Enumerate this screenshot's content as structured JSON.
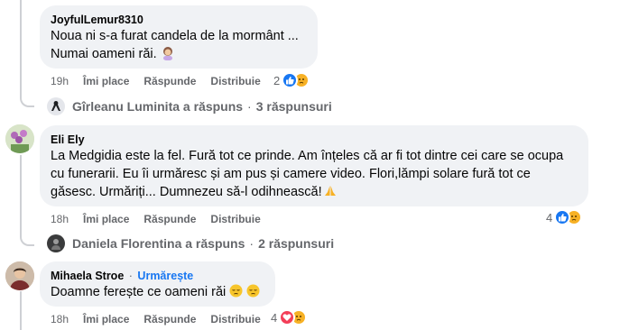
{
  "comments": [
    {
      "author": "JoyfulLemur8310",
      "line1": "Noua ni s-a furat candela de la mormânt ...",
      "line2": "Numai oameni răi.",
      "time": "19h",
      "like": "Îmi place",
      "reply": "Răspunde",
      "share": "Distribuie",
      "reaction_count": "2",
      "reactions": [
        "like-icon",
        "sad-icon"
      ],
      "replies": {
        "name": "Gîrleanu Luminita a răspuns",
        "sep": "·",
        "count": "3 răspunsuri"
      }
    },
    {
      "author": "Eli Ely",
      "line1": "La Medgidia este la fel. Fură tot ce prinde. Am înțeles că ar fi tot dintre cei care se ocupa",
      "line2": "cu funerarii. Eu îi urmăresc și am pus și camere video. Flori,lămpi solare fură tot ce",
      "line3": "găsesc. Urmăriți... Dumnezeu să-l odihnească!",
      "time": "18h",
      "like": "Îmi place",
      "reply": "Răspunde",
      "share": "Distribuie",
      "reaction_count": "4",
      "reactions": [
        "like-icon",
        "sad-icon"
      ],
      "replies": {
        "name": "Daniela Florentina a răspuns",
        "sep": "·",
        "count": "2 răspunsuri"
      }
    },
    {
      "author": "Mihaela Stroe",
      "dot": "·",
      "follow": "Urmărește",
      "line1": "Doamne ferește ce oameni răi",
      "time": "18h",
      "like": "Îmi place",
      "reply": "Răspunde",
      "share": "Distribuie",
      "reaction_count": "4",
      "reactions": [
        "love-icon",
        "sad-icon"
      ]
    }
  ],
  "colors": {
    "link": "#1877f2",
    "bubble": "#f0f2f5",
    "meta": "#65676b",
    "love": "#f33e58",
    "sad": "#f7b125"
  }
}
